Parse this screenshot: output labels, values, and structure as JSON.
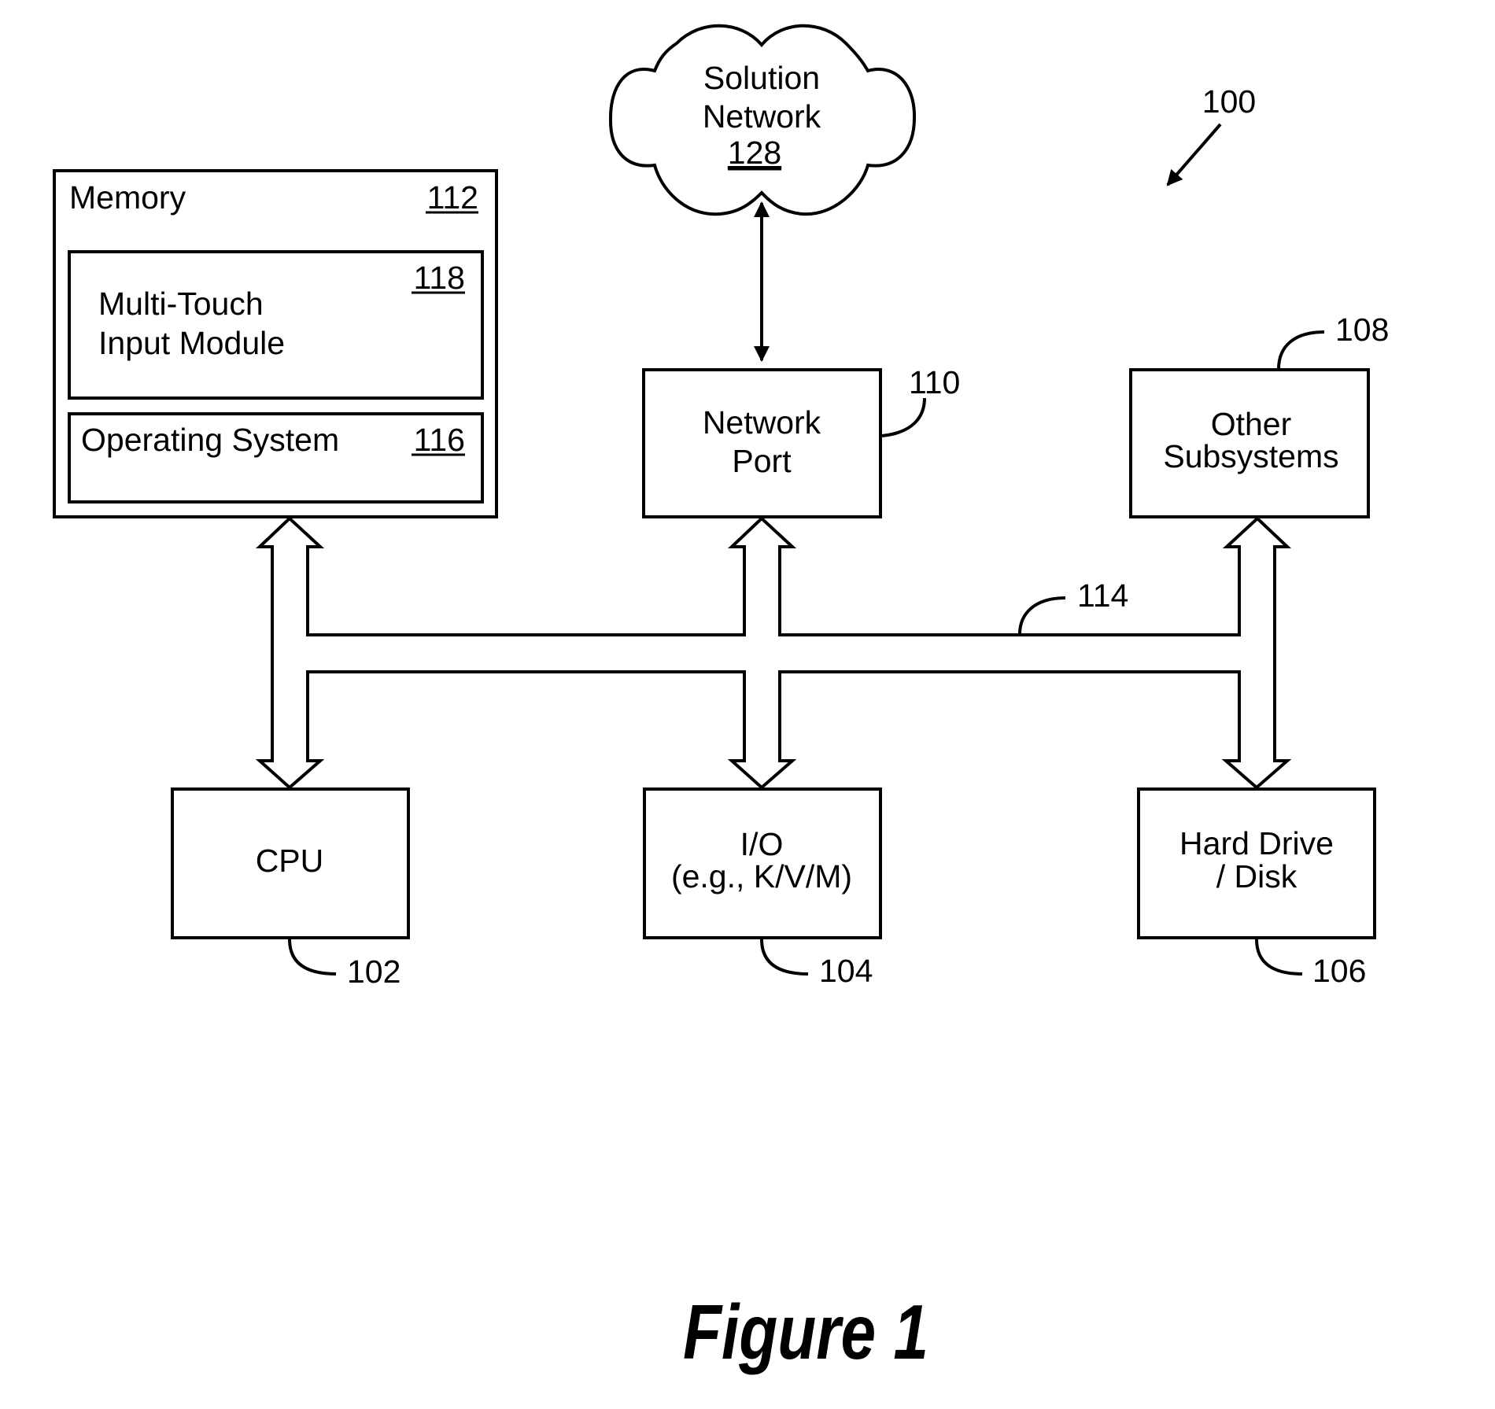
{
  "figure": {
    "caption": "Figure 1",
    "reference": "100"
  },
  "cloud": {
    "line1": "Solution",
    "line2": "Network",
    "ref": "128"
  },
  "memory": {
    "title": "Memory",
    "ref": "112",
    "module": {
      "line1": "Multi-Touch",
      "line2": "Input Module",
      "ref": "118"
    },
    "os": {
      "label": "Operating System",
      "ref": "116"
    }
  },
  "network_port": {
    "line1": "Network",
    "line2": "Port",
    "ref": "110"
  },
  "other_subsystems": {
    "line1": "Other",
    "line2": "Subsystems",
    "ref": "108"
  },
  "bus": {
    "ref": "114"
  },
  "cpu": {
    "label": "CPU",
    "ref": "102"
  },
  "io": {
    "line1": "I/O",
    "line2": "(e.g., K/V/M)",
    "ref": "104"
  },
  "hard_drive": {
    "line1": "Hard Drive",
    "line2": "/ Disk",
    "ref": "106"
  }
}
